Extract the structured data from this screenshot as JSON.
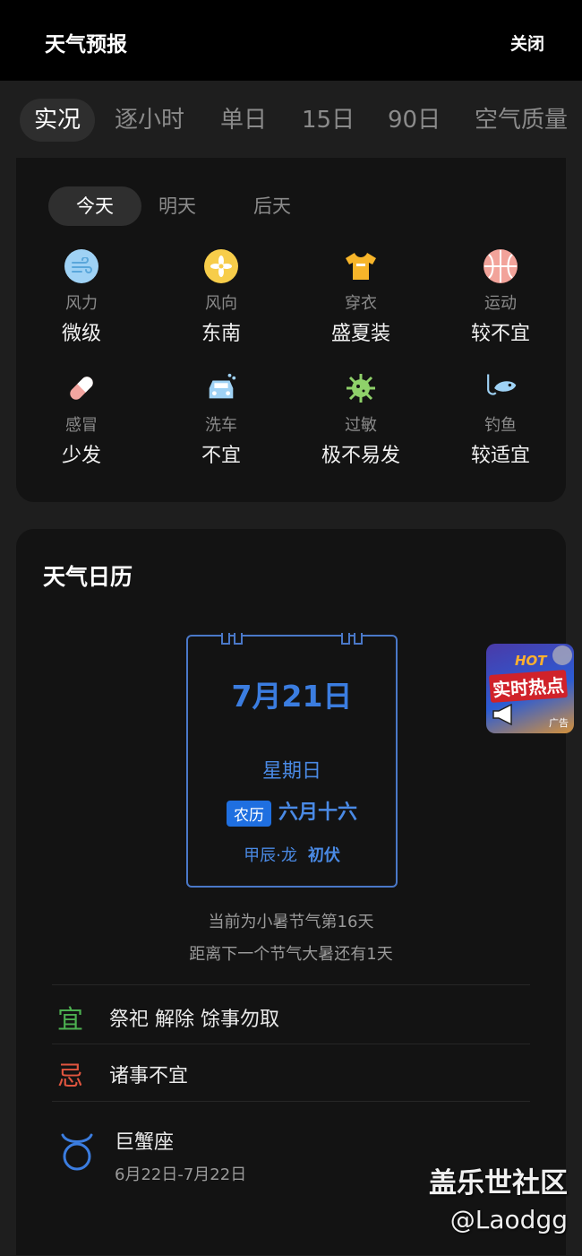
{
  "header": {
    "title": "天气预报",
    "close_label": "关闭"
  },
  "tabs": [
    {
      "label": "实况",
      "active": true
    },
    {
      "label": "逐小时"
    },
    {
      "label": "单日"
    },
    {
      "label": "15日"
    },
    {
      "label": "90日"
    },
    {
      "label": "空气质量"
    }
  ],
  "life": {
    "day_tabs": [
      {
        "label": "今天",
        "active": true
      },
      {
        "label": "明天"
      },
      {
        "label": "后天"
      }
    ],
    "items": [
      {
        "label": "风力",
        "value": "微级",
        "icon": "wind-icon",
        "color": "#9fd2f5"
      },
      {
        "label": "风向",
        "value": "东南",
        "icon": "fan-icon",
        "color": "#f7cd4a"
      },
      {
        "label": "穿衣",
        "value": "盛夏装",
        "icon": "tshirt-icon",
        "color": "#f7b52a"
      },
      {
        "label": "运动",
        "value": "较不宜",
        "icon": "basketball-icon",
        "color": "#f2a39a"
      },
      {
        "label": "感冒",
        "value": "少发",
        "icon": "pill-icon",
        "color": "#f3a5a0"
      },
      {
        "label": "洗车",
        "value": "不宜",
        "icon": "car-icon",
        "color": "#9fd2f5"
      },
      {
        "label": "过敏",
        "value": "极不易发",
        "icon": "virus-icon",
        "color": "#8fd16a"
      },
      {
        "label": "钓鱼",
        "value": "较适宜",
        "icon": "fish-icon",
        "color": "#9fd2f5"
      }
    ]
  },
  "calendar": {
    "title": "天气日历",
    "date": "7月21日",
    "weekday": "星期日",
    "lunar_badge": "农历",
    "lunar_date": "六月十六",
    "ganzhi": "甲辰·龙",
    "season_tag": "初伏",
    "solar_term_line1": "当前为小暑节气第16天",
    "solar_term_line2": "距离下一个节气大暑还有1天",
    "yi_label": "宜",
    "yi_text": "祭祀 解除 馀事勿取",
    "ji_label": "忌",
    "ji_text": "诸事不宜",
    "zodiac_name": "巨蟹座",
    "zodiac_range": "6月22日-7月22日"
  },
  "ad": {
    "hot": "HOT",
    "text": "实时热点",
    "tag": "广告"
  },
  "watermark": {
    "line1": "盖乐世社区",
    "line2": "@Laodgg"
  },
  "colors": {
    "accent": "#3b7de0",
    "yi": "#4caf50",
    "ji": "#e0553f"
  }
}
